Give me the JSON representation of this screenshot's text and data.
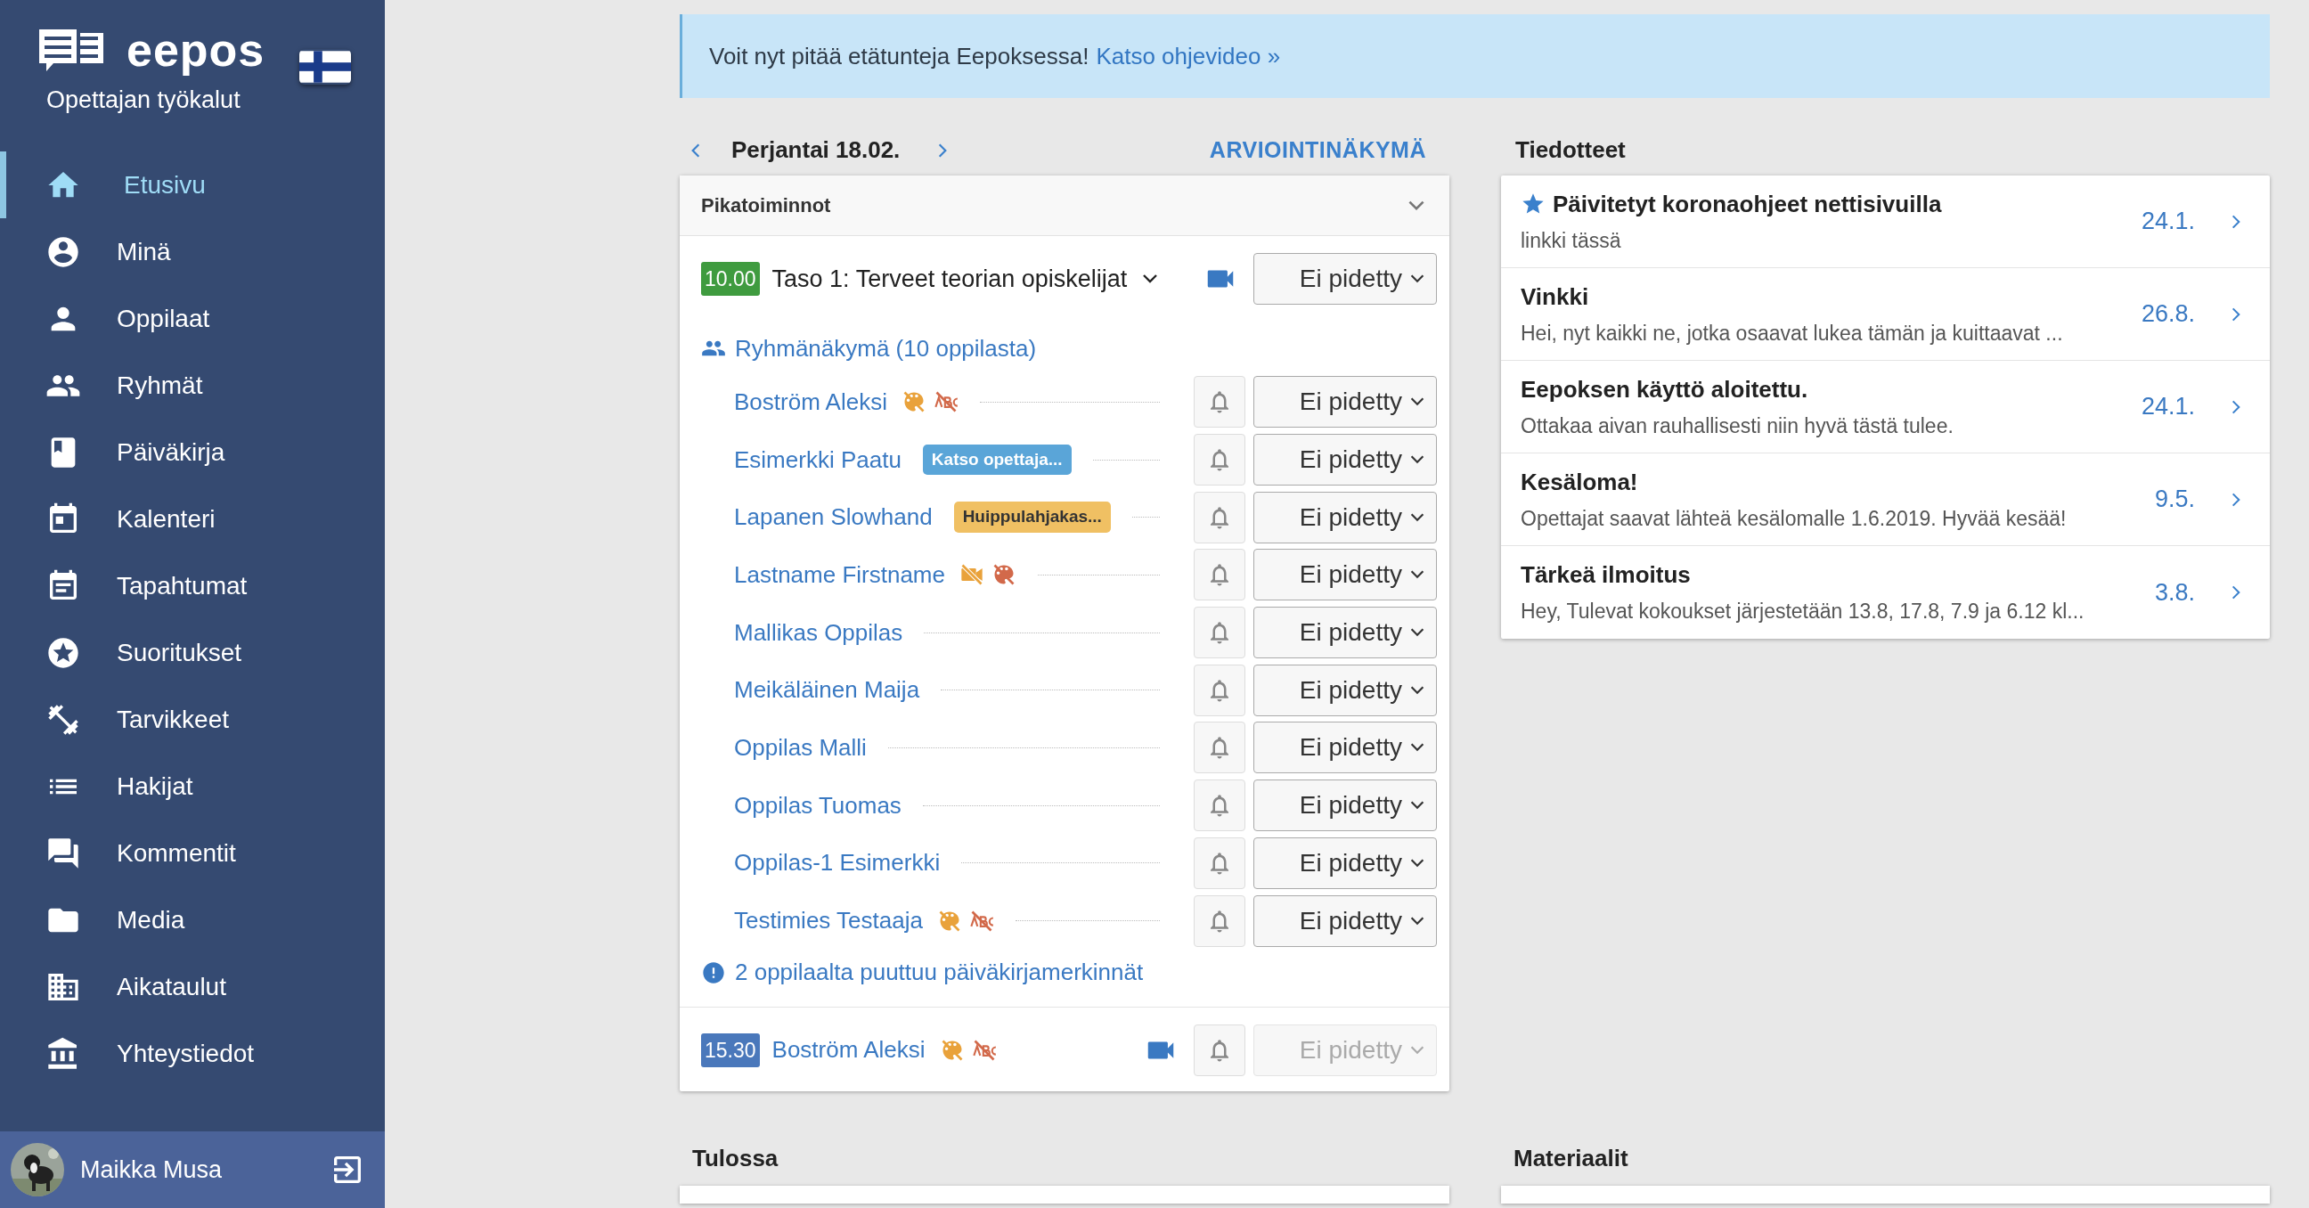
{
  "sidebar": {
    "logo": "eepos",
    "subtitle": "Opettajan työkalut",
    "items": [
      {
        "label": "Etusivu",
        "selected": true
      },
      {
        "label": "Minä",
        "selected": false
      },
      {
        "label": "Oppilaat",
        "selected": false
      },
      {
        "label": "Ryhmät",
        "selected": false
      },
      {
        "label": "Päiväkirja",
        "selected": false
      },
      {
        "label": "Kalenteri",
        "selected": false
      },
      {
        "label": "Tapahtumat",
        "selected": false
      },
      {
        "label": "Suoritukset",
        "selected": false
      },
      {
        "label": "Tarvikkeet",
        "selected": false
      },
      {
        "label": "Hakijat",
        "selected": false
      },
      {
        "label": "Kommentit",
        "selected": false
      },
      {
        "label": "Media",
        "selected": false
      },
      {
        "label": "Aikataulut",
        "selected": false
      },
      {
        "label": "Yhteystiedot",
        "selected": false
      }
    ],
    "user": {
      "name": "Maikka Musa"
    }
  },
  "banner": {
    "text": "Voit nyt pitää etätunteja Eepoksessa!",
    "link": "Katso ohjevideo »"
  },
  "day": {
    "title": "Perjantai 18.02.",
    "view_link": "ARVIOINTINÄKYMÄ"
  },
  "quick_actions": {
    "title": "Pikatoiminnot"
  },
  "lessons": [
    {
      "kind": "group",
      "time": "10.00",
      "color": "#3f9b3f",
      "title": "Taso 1: Terveet teorian opiskelijat",
      "status": "Ei pidetty",
      "disabled": false,
      "group_link": "Ryhmänäkymä (10 oppilasta)",
      "students": [
        {
          "name": "Boström Aleksi",
          "flags": [
            {
              "kind": "no-art",
              "color": "#e9a23b"
            },
            {
              "kind": "no-abc",
              "color": "#d2694a"
            }
          ],
          "status": "Ei pidetty"
        },
        {
          "name": "Esimerkki Paatu",
          "tag": {
            "text": "Katso opettaja...",
            "color": "#5aa5d8"
          },
          "status": "Ei pidetty"
        },
        {
          "name": "Lapanen Slowhand",
          "tag": {
            "text": "Huippulahjakas...",
            "color": "#f0c063"
          },
          "status": "Ei pidetty"
        },
        {
          "name": "Lastname Firstname",
          "flags": [
            {
              "kind": "no-camera",
              "color": "#e9a23b"
            },
            {
              "kind": "no-art",
              "color": "#d2694a"
            }
          ],
          "status": "Ei pidetty"
        },
        {
          "name": "Mallikas Oppilas",
          "status": "Ei pidetty"
        },
        {
          "name": "Meikäläinen Maija",
          "status": "Ei pidetty"
        },
        {
          "name": "Oppilas Malli",
          "status": "Ei pidetty"
        },
        {
          "name": "Oppilas Tuomas",
          "status": "Ei pidetty"
        },
        {
          "name": "Oppilas-1 Esimerkki",
          "status": "Ei pidetty"
        },
        {
          "name": "Testimies Testaaja",
          "flags": [
            {
              "kind": "no-art",
              "color": "#e9a23b"
            },
            {
              "kind": "no-abc",
              "color": "#d2694a"
            }
          ],
          "status": "Ei pidetty"
        }
      ],
      "warning": "2 oppilaalta puuttuu päiväkirjamerkinnät"
    },
    {
      "kind": "single",
      "time": "15.30",
      "color": "#4a78bb",
      "title": "Boström Aleksi",
      "flags": [
        {
          "kind": "no-art",
          "color": "#e9a23b"
        },
        {
          "kind": "no-abc",
          "color": "#d2694a"
        }
      ],
      "status": "Ei pidetty",
      "disabled": true
    }
  ],
  "announcements": {
    "title": "Tiedotteet",
    "items": [
      {
        "title": "Päivitetyt koronaohjeet nettisivuilla",
        "text": "linkki tässä",
        "date": "24.1.",
        "starred": true
      },
      {
        "title": "Vinkki",
        "text": "Hei, nyt kaikki ne, jotka osaavat lukea tämän ja kuittaavat ...",
        "date": "26.8.",
        "starred": false
      },
      {
        "title": "Eepoksen käyttö aloitettu.",
        "text": "Ottakaa aivan rauhallisesti niin hyvä tästä tulee.",
        "date": "24.1.",
        "starred": false
      },
      {
        "title": "Kesäloma!",
        "text": "Opettajat saavat lähteä kesälomalle 1.6.2019. Hyvää kesää!",
        "date": "9.5.",
        "starred": false
      },
      {
        "title": "Tärkeä ilmoitus",
        "text": "Hey, Tulevat kokoukset järjestetään 13.8, 17.8, 7.9 ja 6.12 kl...",
        "date": "3.8.",
        "starred": false
      }
    ]
  },
  "bottom": {
    "left_title": "Tulossa",
    "right_title": "Materiaalit"
  }
}
